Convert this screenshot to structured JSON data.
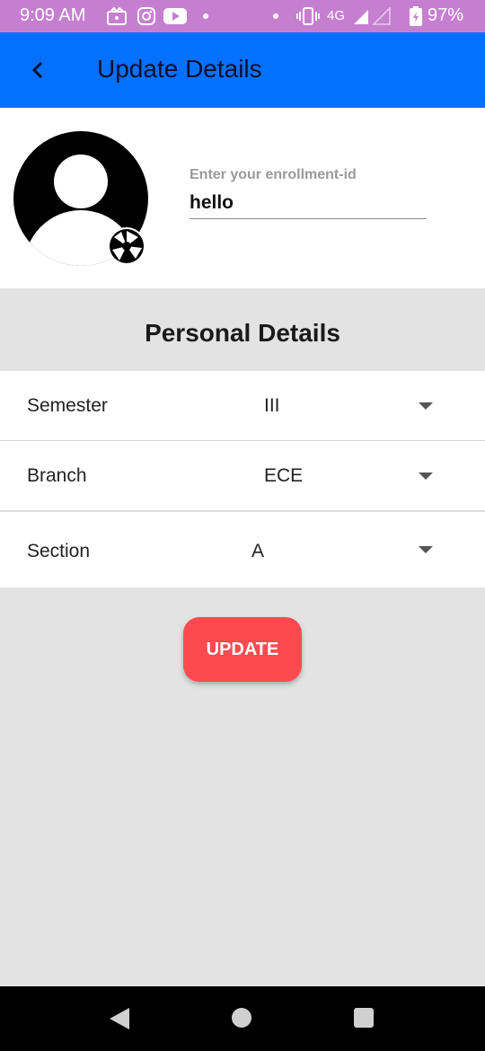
{
  "status_bar": {
    "time": "9:09 AM",
    "network": "4G",
    "battery": "97%",
    "icons": [
      "gallery-icon",
      "instagram-icon",
      "youtube-icon",
      "dot-icon",
      "vibrate-icon",
      "signal-icon",
      "battery-icon"
    ]
  },
  "app_bar": {
    "title": "Update Details",
    "back_icon": "chevron-left-icon",
    "color": "#0470fe"
  },
  "profile": {
    "enrollment_label": "Enter your enrollment-id",
    "enrollment_value": "hello",
    "avatar_icon": "person-icon",
    "camera_icon": "camera-aperture-icon"
  },
  "section": {
    "title": "Personal Details"
  },
  "fields": {
    "semester": {
      "label": "Semester",
      "value": "III"
    },
    "branch": {
      "label": "Branch",
      "value": "ECE"
    },
    "section": {
      "label": "Section",
      "value": "A"
    }
  },
  "actions": {
    "update_label": "UPDATE",
    "update_color": "#fe4a4f"
  },
  "nav": {
    "icons": [
      "back-triangle-icon",
      "home-circle-icon",
      "recents-square-icon"
    ]
  }
}
